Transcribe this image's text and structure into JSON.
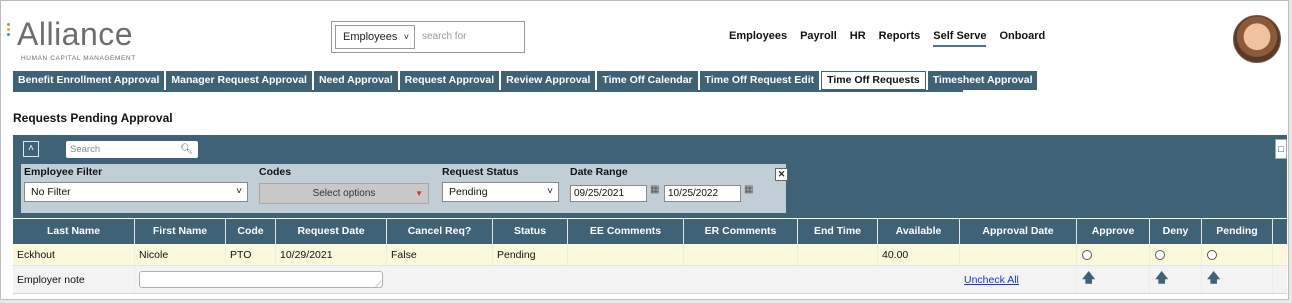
{
  "brand": {
    "name": "Alliance",
    "tagline": "HUMAN CAPITAL MANAGEMENT",
    "dot_colors": [
      "#7cb342",
      "#f5a623",
      "#3b8fc4"
    ]
  },
  "search": {
    "category": "Employees",
    "placeholder": "search for"
  },
  "topnav": [
    {
      "label": "Employees",
      "active": false
    },
    {
      "label": "Payroll",
      "active": false
    },
    {
      "label": "HR",
      "active": false
    },
    {
      "label": "Reports",
      "active": false
    },
    {
      "label": "Self Serve",
      "active": true
    },
    {
      "label": "Onboard",
      "active": false
    }
  ],
  "tabs": [
    {
      "label": "Benefit Enrollment Approval",
      "active": false
    },
    {
      "label": "Manager Request Approval",
      "active": false
    },
    {
      "label": "Need Approval",
      "active": false
    },
    {
      "label": "Request Approval",
      "active": false
    },
    {
      "label": "Review Approval",
      "active": false
    },
    {
      "label": "Time Off Calendar",
      "active": false
    },
    {
      "label": "Time Off Request Edit",
      "active": false
    },
    {
      "label": "Time Off Requests",
      "active": true
    },
    {
      "label": "Timesheet Approval",
      "active": false
    }
  ],
  "page_title": "Requests Pending Approval",
  "panel": {
    "search_placeholder": "Search",
    "filters": {
      "employee_filter_label": "Employee Filter",
      "employee_filter_value": "No Filter",
      "codes_label": "Codes",
      "codes_button": "Select options",
      "request_status_label": "Request Status",
      "request_status_value": "Pending",
      "date_range_label": "Date Range",
      "date_from": "09/25/2021",
      "date_to": "10/25/2022"
    }
  },
  "table": {
    "columns": [
      "Last Name",
      "First Name",
      "Code",
      "Request Date",
      "Cancel Req?",
      "Status",
      "EE Comments",
      "ER Comments",
      "End Time",
      "Available",
      "Approval Date",
      "Approve",
      "Deny",
      "Pending"
    ],
    "rows": [
      {
        "last_name": "Eckhout",
        "first_name": "Nicole",
        "code": "PTO",
        "request_date": "10/29/2021",
        "cancel_req": "False",
        "status": "Pending",
        "ee_comments": "",
        "er_comments": "",
        "end_time": "",
        "available": "40.00",
        "approval_date": ""
      }
    ],
    "employer_note_label": "Employer note",
    "uncheck_all": "Uncheck All"
  },
  "colors": {
    "accent": "#3f6276",
    "filter_bg": "#c2ced6",
    "row_highlight": "#fcf8dc",
    "link": "#1a35c9"
  }
}
